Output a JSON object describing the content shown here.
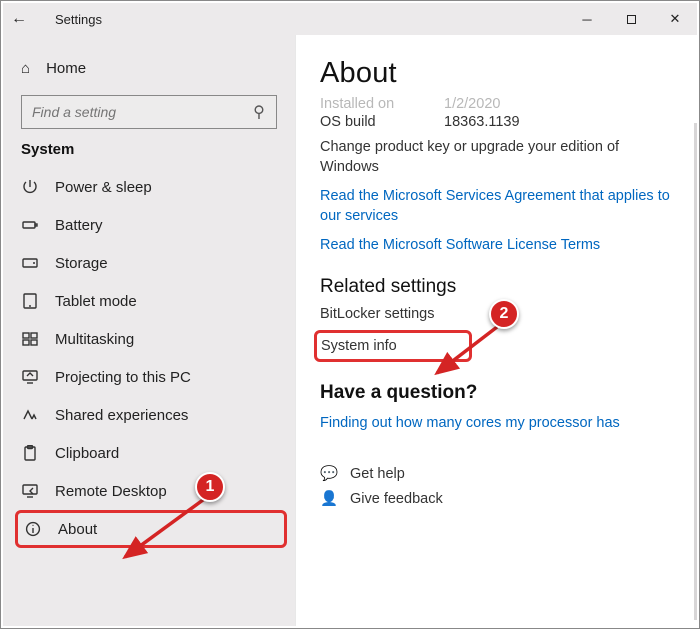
{
  "window": {
    "title": "Settings"
  },
  "sidebar": {
    "home": "Home",
    "search_placeholder": "Find a setting",
    "category": "System",
    "items": [
      {
        "label": "Power & sleep",
        "icon": "power-icon"
      },
      {
        "label": "Battery",
        "icon": "battery-icon"
      },
      {
        "label": "Storage",
        "icon": "storage-icon"
      },
      {
        "label": "Tablet mode",
        "icon": "tablet-icon"
      },
      {
        "label": "Multitasking",
        "icon": "multitasking-icon"
      },
      {
        "label": "Projecting to this PC",
        "icon": "projecting-icon"
      },
      {
        "label": "Shared experiences",
        "icon": "shared-experiences-icon"
      },
      {
        "label": "Clipboard",
        "icon": "clipboard-icon"
      },
      {
        "label": "Remote Desktop",
        "icon": "remote-desktop-icon"
      },
      {
        "label": "About",
        "icon": "about-icon"
      }
    ]
  },
  "content": {
    "title": "About",
    "spec_installed_label": "Installed on",
    "spec_installed_value": "1/2/2020",
    "spec_build_label": "OS build",
    "spec_build_value": "18363.1139",
    "change_key": "Change product key or upgrade your edition of Windows",
    "msa": "Read the Microsoft Services Agreement that applies to our services",
    "license": "Read the Microsoft Software License Terms",
    "related_heading": "Related settings",
    "bitlocker": "BitLocker settings",
    "sysinfo": "System info",
    "question_heading": "Have a question?",
    "question_link": "Finding out how many cores my processor has",
    "get_help": "Get help",
    "feedback": "Give feedback"
  },
  "annotations": {
    "badge1": "1",
    "badge2": "2"
  }
}
